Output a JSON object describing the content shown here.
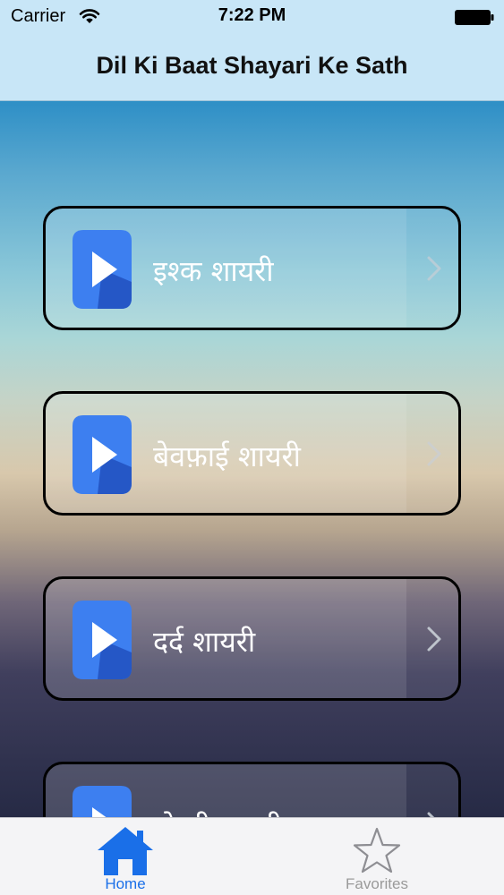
{
  "status_bar": {
    "carrier": "Carrier",
    "time": "7:22 PM"
  },
  "nav": {
    "title": "Dil Ki Baat Shayari Ke Sath"
  },
  "categories": [
    {
      "label": "इश्क शायरी",
      "icon": "play-icon"
    },
    {
      "label": "बेवफ़ाई शायरी",
      "icon": "play-icon"
    },
    {
      "label": "दर्द शायरी",
      "icon": "play-icon"
    },
    {
      "label": "दोस्ती शायरी",
      "icon": "play-icon"
    }
  ],
  "tabbar": {
    "home_label": "Home",
    "favorites_label": "Favorites",
    "active_color": "#1a6fe8",
    "inactive_color": "#9a9a9a"
  },
  "colors": {
    "nav_background": "#c8e6f7",
    "icon_blue": "#3d7ff0",
    "icon_dark": "#2557c6"
  }
}
